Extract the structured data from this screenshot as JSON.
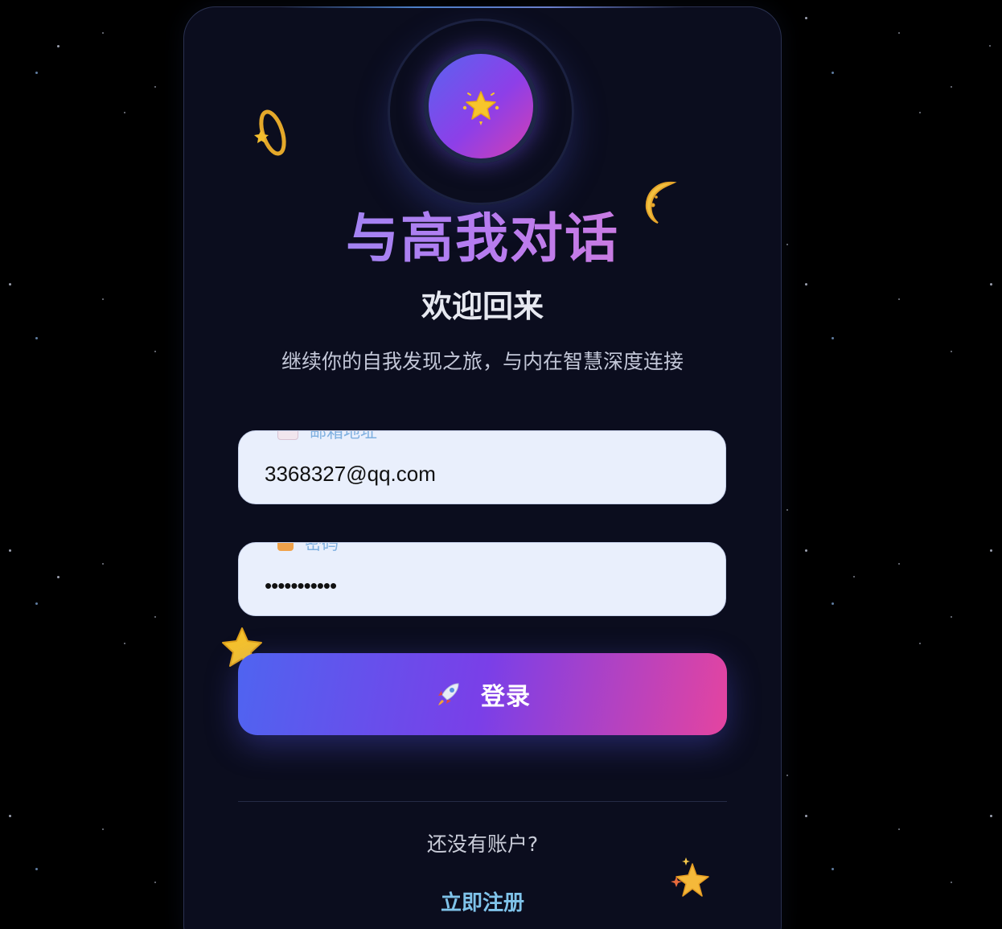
{
  "app": {
    "title": "与高我对话",
    "welcome": "欢迎回来",
    "subtitle": "继续你的自我发现之旅，与内在智慧深度连接",
    "logo_icon": "star-icon"
  },
  "form": {
    "email": {
      "label": "邮箱地址",
      "value": "3368327@qq.com",
      "icon": "envelope-icon"
    },
    "password": {
      "label": "密码",
      "value": "•••••••••••",
      "icon": "lock-icon"
    },
    "submit": {
      "label": "登录",
      "icon": "rocket-icon"
    }
  },
  "footer": {
    "prompt": "还没有账户?",
    "register_label": "立即注册"
  },
  "decorations": [
    "shooting-star-icon",
    "crescent-moon-icon",
    "star-icon",
    "sparkles-icon"
  ],
  "colors": {
    "background": "#000000",
    "card": "#0b0d1e",
    "accent_start": "#4f64f0",
    "accent_mid": "#7a3fe8",
    "accent_end": "#e444a0",
    "link": "#7fc3ea",
    "input_bg": "#e9effc"
  }
}
